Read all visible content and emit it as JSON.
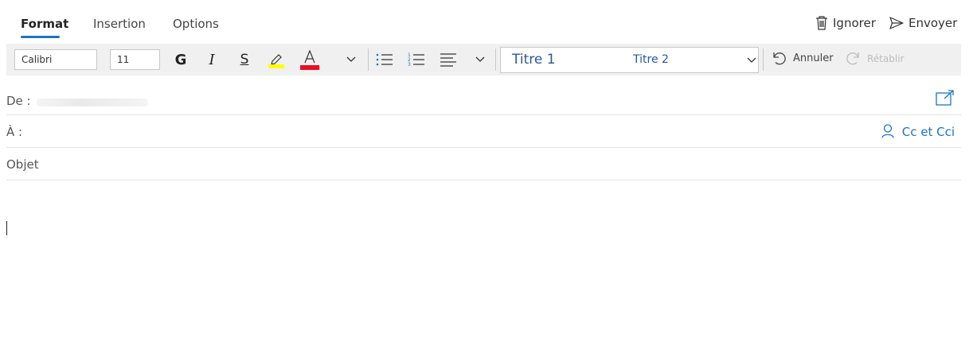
{
  "tabs": [
    {
      "label": "Format",
      "active": true
    },
    {
      "label": "Insertion",
      "active": false
    },
    {
      "label": "Options",
      "active": false
    }
  ],
  "actions": {
    "discard_label": "Ignorer",
    "send_label": "Envoyer"
  },
  "toolbar": {
    "font_name": "Calibri",
    "font_size": "11",
    "bold_glyph": "G",
    "italic_glyph": "I",
    "strike_glyph": "S",
    "font_color_glyph": "A",
    "highlight_color": "#ffff00",
    "font_color": "#e81123",
    "style_titre1": "Titre 1",
    "style_titre2": "Titre 2",
    "undo_label": "Annuler",
    "redo_label": "Rétablir"
  },
  "fields": {
    "from_label": "De :",
    "to_label": "À :",
    "cc_bcc_label": "Cc et Cci",
    "subject_label": "Objet"
  },
  "colors": {
    "accent": "#1e73be",
    "style_text": "#2b579a"
  }
}
